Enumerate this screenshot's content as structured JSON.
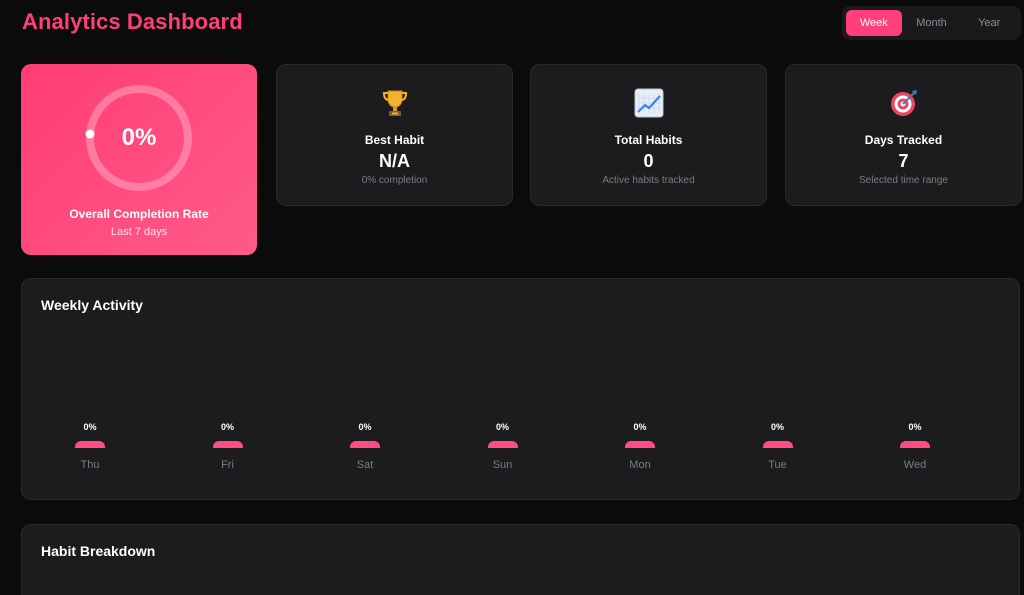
{
  "header": {
    "title": "Analytics Dashboard",
    "ranges": [
      {
        "label": "Week",
        "active": true
      },
      {
        "label": "Month",
        "active": false
      },
      {
        "label": "Year",
        "active": false
      }
    ]
  },
  "hero": {
    "value": "0%",
    "progress": 0,
    "label": "Overall Completion Rate",
    "sub": "Last 7 days"
  },
  "stats": [
    {
      "icon": "trophy-icon",
      "label": "Best Habit",
      "value": "N/A",
      "sub": "0% completion"
    },
    {
      "icon": "chart-increasing-icon",
      "label": "Total Habits",
      "value": "0",
      "sub": "Active habits tracked"
    },
    {
      "icon": "target-icon",
      "label": "Days Tracked",
      "value": "7",
      "sub": "Selected time range"
    }
  ],
  "weekly": {
    "title": "Weekly Activity"
  },
  "breakdown": {
    "title": "Habit Breakdown"
  },
  "colors": {
    "accent": "#ff3f7a",
    "background": "#0b0b0c",
    "card": "#1c1c1e"
  },
  "chart_data": {
    "type": "bar",
    "title": "Weekly Activity",
    "categories": [
      "Thu",
      "Fri",
      "Sat",
      "Sun",
      "Mon",
      "Tue",
      "Wed"
    ],
    "values": [
      0,
      0,
      0,
      0,
      0,
      0,
      0
    ],
    "value_labels": [
      "0%",
      "0%",
      "0%",
      "0%",
      "0%",
      "0%",
      "0%"
    ],
    "ylim": [
      0,
      100
    ],
    "grid": false
  }
}
